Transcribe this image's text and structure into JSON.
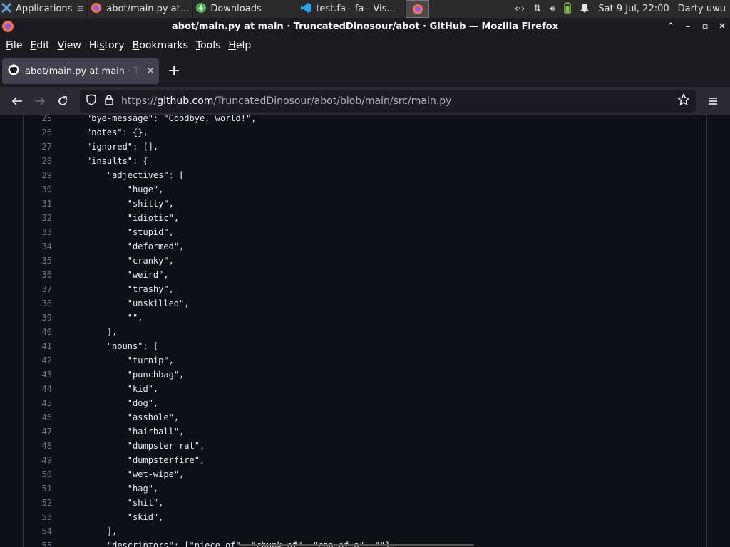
{
  "panel": {
    "apps_label": "Applications",
    "tasks": [
      {
        "label": "abot/main.py at..."
      },
      {
        "label": "Downloads"
      },
      {
        "label": "test.fa - fa - Vis..."
      }
    ],
    "clock": "Sat  9 Jul, 22:00",
    "user": "Darty uwu"
  },
  "window": {
    "title": "abot/main.py at main · TruncatedDinosour/abot · GitHub — Mozilla Firefox"
  },
  "menu": {
    "items": [
      {
        "label": "File",
        "key": "F",
        "rest": "ile"
      },
      {
        "label": "Edit",
        "key": "E",
        "rest": "dit"
      },
      {
        "label": "View",
        "key": "V",
        "rest": "iew"
      },
      {
        "label": "History",
        "key": "s",
        "pre": "Hi",
        "rest": "tory"
      },
      {
        "label": "Bookmarks",
        "key": "B",
        "rest": "ookmarks"
      },
      {
        "label": "Tools",
        "key": "T",
        "rest": "ools"
      },
      {
        "label": "Help",
        "key": "H",
        "rest": "elp"
      }
    ]
  },
  "tab": {
    "title": "abot/main.py at main · TruncatedDinosour/abot"
  },
  "urlbar": {
    "url_prefix": "https://",
    "url_host": "github.com",
    "url_path": "/TruncatedDinosour/abot/blob/main/src/main.py"
  },
  "code": {
    "lines": [
      {
        "n": "25",
        "t": "\"bye-message\": \"Goodbye, world!\","
      },
      {
        "n": "26",
        "t": "\"notes\": {},"
      },
      {
        "n": "27",
        "t": "\"ignored\": [],"
      },
      {
        "n": "28",
        "t": "\"insults\": {"
      },
      {
        "n": "29",
        "t": "    \"adjectives\": ["
      },
      {
        "n": "30",
        "t": "        \"huge\","
      },
      {
        "n": "31",
        "t": "        \"shitty\","
      },
      {
        "n": "32",
        "t": "        \"idiotic\","
      },
      {
        "n": "33",
        "t": "        \"stupid\","
      },
      {
        "n": "34",
        "t": "        \"deformed\","
      },
      {
        "n": "35",
        "t": "        \"cranky\","
      },
      {
        "n": "36",
        "t": "        \"weird\","
      },
      {
        "n": "37",
        "t": "        \"trashy\","
      },
      {
        "n": "38",
        "t": "        \"unskilled\","
      },
      {
        "n": "39",
        "t": "        \"\","
      },
      {
        "n": "40",
        "t": "    ],"
      },
      {
        "n": "41",
        "t": "    \"nouns\": ["
      },
      {
        "n": "42",
        "t": "        \"turnip\","
      },
      {
        "n": "43",
        "t": "        \"punchbag\","
      },
      {
        "n": "44",
        "t": "        \"kid\","
      },
      {
        "n": "45",
        "t": "        \"dog\","
      },
      {
        "n": "46",
        "t": "        \"asshole\","
      },
      {
        "n": "47",
        "t": "        \"hairball\","
      },
      {
        "n": "48",
        "t": "        \"dumpster rat\","
      },
      {
        "n": "49",
        "t": "        \"dumpsterfire\","
      },
      {
        "n": "50",
        "t": "        \"wet-wipe\","
      },
      {
        "n": "51",
        "t": "        \"hag\","
      },
      {
        "n": "52",
        "t": "        \"shit\","
      },
      {
        "n": "53",
        "t": "        \"skid\","
      },
      {
        "n": "54",
        "t": "    ],"
      },
      {
        "n": "55",
        "t": "    \"descriptors\": [\"piece of\", \"chunk of\", \"cap of a\", \"\"],"
      }
    ]
  },
  "colors": {
    "page_bg": "#0d1117",
    "browser_chrome": "#1c1b22",
    "accent_ff": "#ff7139"
  }
}
